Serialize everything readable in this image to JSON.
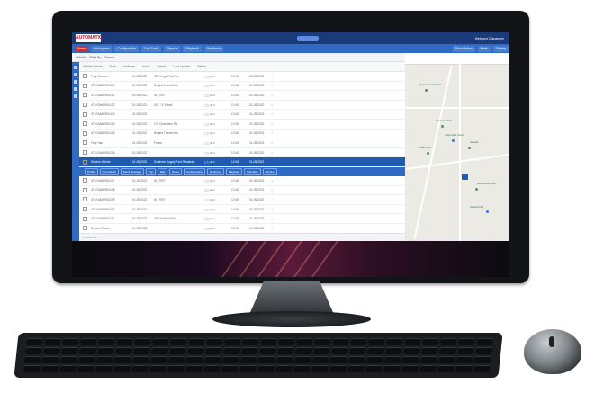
{
  "app": {
    "logo_text": "AUTOMATIC",
    "user_label": "Welcome Dispatcher",
    "nav": [
      "Alerts",
      "Workspace",
      "Configuration",
      "Live Track",
      "Reports",
      "Playback",
      "Geofence"
    ],
    "nav_right": [
      "Show Active",
      "Fleet",
      "Display"
    ],
    "filters": [
      "Vehicle",
      "Filter By",
      "Search"
    ],
    "table_headers": [
      "Vehicle Name",
      "Date",
      "Address",
      "Icons",
      "Speed",
      "Last Update",
      "Status"
    ],
    "rows": [
      {
        "vin": "Frey Flammer",
        "dt": "01-05-2022",
        "addr": "387 Kings Park Rd",
        "ic": "◻◻⊕⊙",
        "sp": "12:45",
        "dt2": "01-05-2022",
        "st": "✓"
      },
      {
        "vin": "4T1K3A6F9EA100",
        "dt": "01-05-2022",
        "addr": "Regina Transit Ave",
        "ic": "◻◻⊕⊙",
        "sp": "12:45",
        "dt2": "01-05-2022",
        "st": "✓"
      },
      {
        "vin": "4T1K3A6F9EA101",
        "dt": "01-05-2022",
        "addr": "51_7907",
        "ic": "◻◻⊕⊙",
        "sp": "12:45",
        "dt2": "01-05-2022",
        "st": "✓",
        "sel": false
      },
      {
        "vin": "4T1K3A6F9EA102",
        "dt": "01-05-2022",
        "addr": "181 7 E Street",
        "ic": "◻◻⊕⊙",
        "sp": "12:45",
        "dt2": "01-05-2022",
        "st": "✓"
      },
      {
        "vin": "4T1K3A6F9EA103",
        "dt": "01-05-2022",
        "addr": "",
        "ic": "◻◻⊕⊙",
        "sp": "12:45",
        "dt2": "01-05-2022",
        "st": "✓"
      },
      {
        "vin": "4T1K3A6F9EA104",
        "dt": "01-05-2022",
        "addr": "170 Chambers Rd",
        "ic": "◻◻⊕⊙",
        "sp": "12:45",
        "dt2": "01-05-2022",
        "st": "✓"
      },
      {
        "vin": "4T1K3A6F9EA105",
        "dt": "01-05-2022",
        "addr": "Regina Transit Ave",
        "ic": "◻◻⊕⊙",
        "sp": "12:45",
        "dt2": "01-05-2022",
        "st": "✓"
      },
      {
        "vin": "Frey Hau",
        "dt": "01-05-2022",
        "addr": "Frazer",
        "ic": "◻◻⊕⊙",
        "sp": "12:45",
        "dt2": "01-05-2022",
        "st": "✓"
      },
      {
        "vin": "4T1K3A6F9EA106",
        "dt": "01-05-2022",
        "addr": "",
        "ic": "◻◻⊕⊙",
        "sp": "12:45",
        "dt2": "01-05-2022",
        "st": "✓"
      },
      {
        "vin": "Service Vehicle",
        "dt": "01-05-2022",
        "addr": "Southern Supply Ford Roadway",
        "ic": "◻◻⊕⊙",
        "sp": "12:45",
        "dt2": "01-05-2022",
        "st": "✓",
        "sel": true
      }
    ],
    "action_buttons": [
      "Profile",
      "Commands",
      "Send Message",
      "Trip",
      "Edit",
      "Notes",
      "Configuration",
      "Geofence",
      "Playback",
      "Schedule",
      "Service"
    ],
    "rows2": [
      {
        "vin": "4T1K3A6F9EA107",
        "dt": "01-05-2022",
        "addr": "51_7907",
        "ic": "◻◻⊕⊙",
        "sp": "12:45",
        "dt2": "01-05-2022",
        "st": "✓"
      },
      {
        "vin": "4T1K3A6F9EA108",
        "dt": "01-05-2022",
        "addr": "",
        "ic": "◻◻⊕⊙",
        "sp": "12:45",
        "dt2": "01-05-2022",
        "st": "✓"
      },
      {
        "vin": "4T1K3A6F9EA109",
        "dt": "01-05-2022",
        "addr": "51_7907",
        "ic": "◻◻⊕⊙",
        "sp": "12:45",
        "dt2": "01-05-2022",
        "st": "✓"
      },
      {
        "vin": "4T1K3A6F9EA110",
        "dt": "01-05-2022",
        "addr": "",
        "ic": "◻◻⊕⊙",
        "sp": "12:45",
        "dt2": "01-05-2022",
        "st": "✓"
      },
      {
        "vin": "4T1K3A6F9EA111",
        "dt": "01-05-2022",
        "addr": "40 T Hartford Rd",
        "ic": "◻◻⊕⊙",
        "sp": "12:45",
        "dt2": "01-05-2022",
        "st": "✓"
      },
      {
        "vin": "Repair 1 Tower",
        "dt": "01-05-2022",
        "addr": "",
        "ic": "◻◻⊕⊙",
        "sp": "12:45",
        "dt2": "01-05-2022",
        "st": "✓"
      }
    ],
    "footer_text": "1 - 20 of 35",
    "map_labels": [
      "Regina Heritage Park",
      "Centennial Park",
      "Grace Reid Center",
      "Hospital",
      "Alden Park",
      "Marlborough Park",
      "Kiwanis Park"
    ]
  },
  "colors": {
    "nav_blue": "#2f6bc4",
    "top_blue": "#1b3a7a",
    "alert_red": "#d12b2b",
    "selected_row": "#1f5bb0"
  }
}
